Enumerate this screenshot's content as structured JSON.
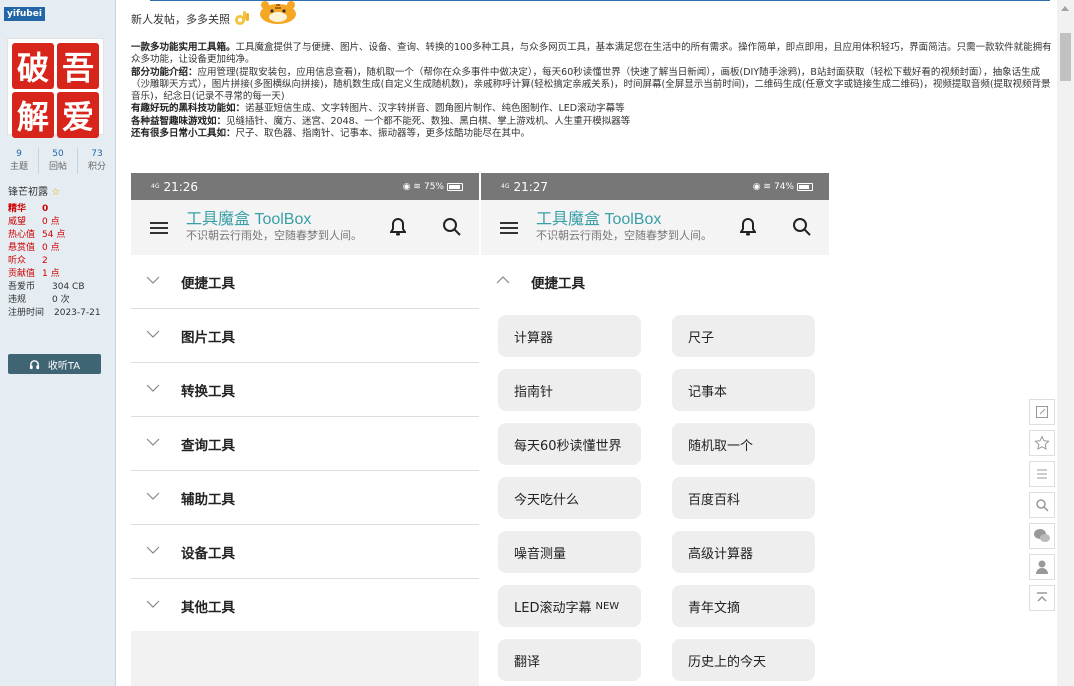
{
  "sidebar": {
    "username": "yifubei",
    "avatar_chars": [
      "破",
      "吾",
      "解",
      "爱"
    ],
    "stats": [
      {
        "num": "9",
        "label": "主题"
      },
      {
        "num": "50",
        "label": "回帖"
      },
      {
        "num": "73",
        "label": "积分"
      }
    ],
    "rank": "锋芒初露",
    "info": [
      {
        "k": "精华",
        "v": "0"
      },
      {
        "k": "威望",
        "v": "0 点"
      },
      {
        "k": "热心值",
        "v": "54 点"
      },
      {
        "k": "悬赏值",
        "v": "0 点"
      },
      {
        "k": "听众",
        "v": "2"
      },
      {
        "k": "贡献值",
        "v": "1 点"
      },
      {
        "k": "吾爱币",
        "v": "304 CB"
      },
      {
        "k": "违规",
        "v": "0 次"
      },
      {
        "k": "注册时间",
        "v": "2023-7-21"
      }
    ],
    "listen_label": "收听TA"
  },
  "post": {
    "greeting": "新人发帖，多多关照",
    "p1_bold": "一款多功能实用工具箱。",
    "p1": "工具魔盒提供了与便捷、图片、设备、查询、转换的100多种工具，与众多网页工具，基本满足您在生活中的所有需求。操作简单，即点即用，且应用体积轻巧，界面简洁。只需一款软件就能拥有众多功能，让设备更加纯净。",
    "p2_bold": "部分功能介绍：",
    "p2": "应用管理(提取安装包，应用信息查看)，随机取一个（帮你在众多事件中做决定），每天60秒读懂世界（快速了解当日新闻），画板(DIY随手涂鸦)，B站封面获取（轻松下载好看的视频封面），抽象话生成（沙雕聊天方式），图片拼接(多图横纵向拼接)，随机数生成(自定义生成随机数)，亲戚称呼计算(轻松搞定亲戚关系)，时间屏幕(全屏显示当前时间)，二维码生成(任意文字或链接生成二维码)，视频提取音频(提取视频背景音乐)，纪念日(记录不寻常的每一天)",
    "p3_bold": "有趣好玩的黑科技功能如：",
    "p3": "诺基亚短信生成、文字转图片、汉字转拼音、圆角图片制作、纯色图制作、LED滚动字幕等",
    "p4_bold": "各种益智趣味游戏如：",
    "p4": "见缝插针、魔方、迷宫、2048、一个都不能死、数独、黑白棋、掌上游戏机、人生重开模拟器等",
    "p5_bold": "还有很多日常小工具如：",
    "p5": "尺子、取色器、指南针、记事本、振动器等，更多炫酷功能尽在其中。"
  },
  "phone_left": {
    "time": "21:26",
    "signal": "4G",
    "battery": "75%",
    "app_title": "工具魔盒 ToolBox",
    "app_subtitle": "不识朝云行雨处，空随春梦到人间。",
    "categories": [
      "便捷工具",
      "图片工具",
      "转换工具",
      "查询工具",
      "辅助工具",
      "设备工具",
      "其他工具"
    ]
  },
  "phone_right": {
    "time": "21:27",
    "signal": "4G",
    "battery": "74%",
    "app_title": "工具魔盒 ToolBox",
    "app_subtitle": "不识朝云行雨处，空随春梦到人间。",
    "open_category": "便捷工具",
    "tools": [
      "计算器",
      "尺子",
      "指南针",
      "记事本",
      "每天60秒读懂世界",
      "随机取一个",
      "今天吃什么",
      "百度百科",
      "噪音测量",
      "高级计算器",
      "LED滚动字幕",
      "青年文摘",
      "翻译",
      "历史上的今天"
    ],
    "new_badge": "NEW"
  },
  "colors": {
    "sidebar_bg": "#e5edf2",
    "accent_blue": "#2366a8",
    "brand_teal": "#3a9fa6",
    "status_bar": "#777777",
    "danger_red": "#cc0000"
  }
}
